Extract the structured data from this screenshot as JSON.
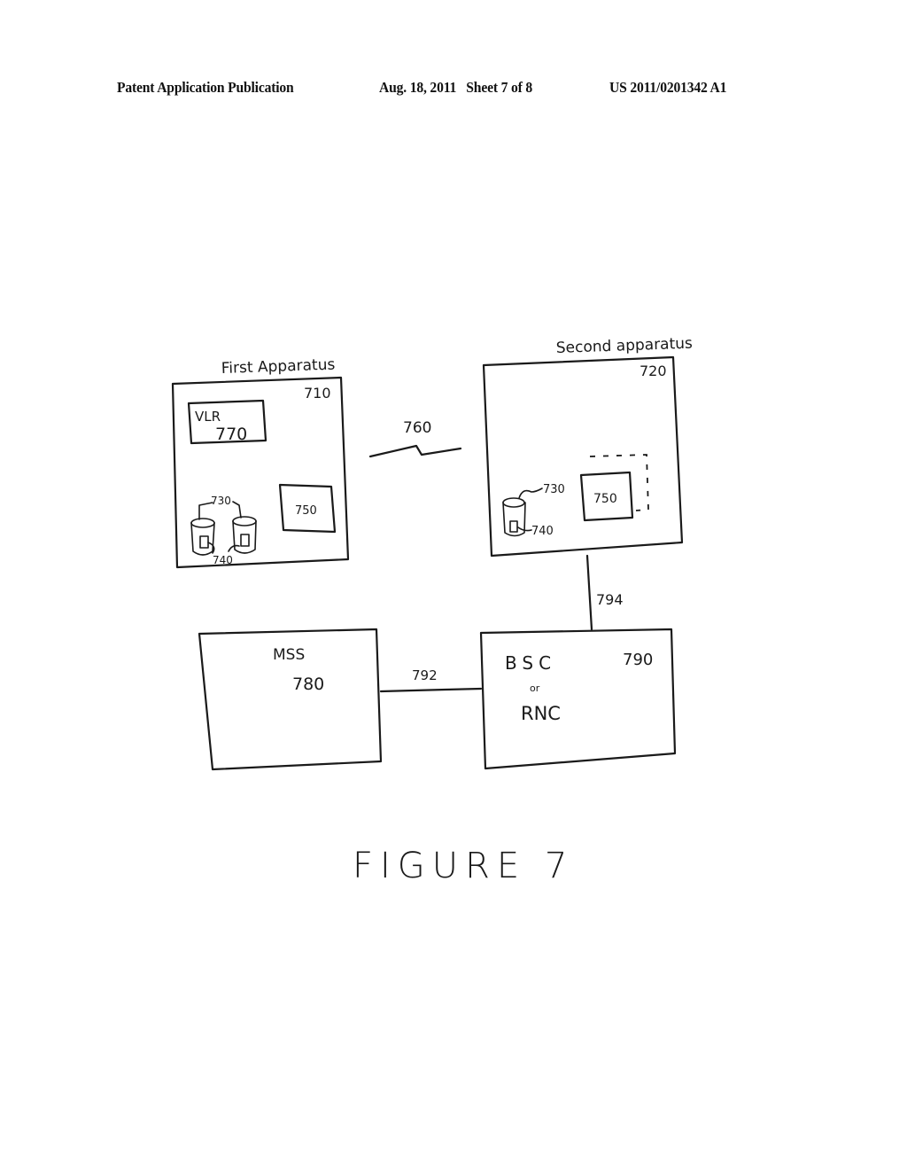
{
  "header": {
    "publication": "Patent Application Publication",
    "date_sheet": "Aug. 18, 2011   Sheet 7 of 8",
    "number": "US 2011/0201342 A1"
  },
  "figure": {
    "caption": "FIGURE 7",
    "nodes": {
      "first_apparatus": {
        "title": "First Apparatus",
        "ref": "710"
      },
      "second_apparatus": {
        "title": "Second apparatus",
        "ref": "720"
      },
      "vlr": {
        "label": "VLR",
        "ref": "770"
      },
      "first_750": {
        "ref": "750"
      },
      "second_750": {
        "ref": "750"
      },
      "first_730": {
        "ref": "730"
      },
      "first_740": {
        "ref": "740"
      },
      "second_730": {
        "ref": "730"
      },
      "second_740": {
        "ref": "740"
      },
      "mss": {
        "label": "MSS",
        "ref": "780"
      },
      "bsc_rnc": {
        "label_1": "BSC",
        "label_or": "or",
        "label_2": "RNC",
        "ref": "790"
      }
    },
    "links": {
      "wireless": {
        "ref": "760"
      },
      "mss_bsc": {
        "ref": "792"
      },
      "second_bsc": {
        "ref": "794"
      }
    }
  }
}
